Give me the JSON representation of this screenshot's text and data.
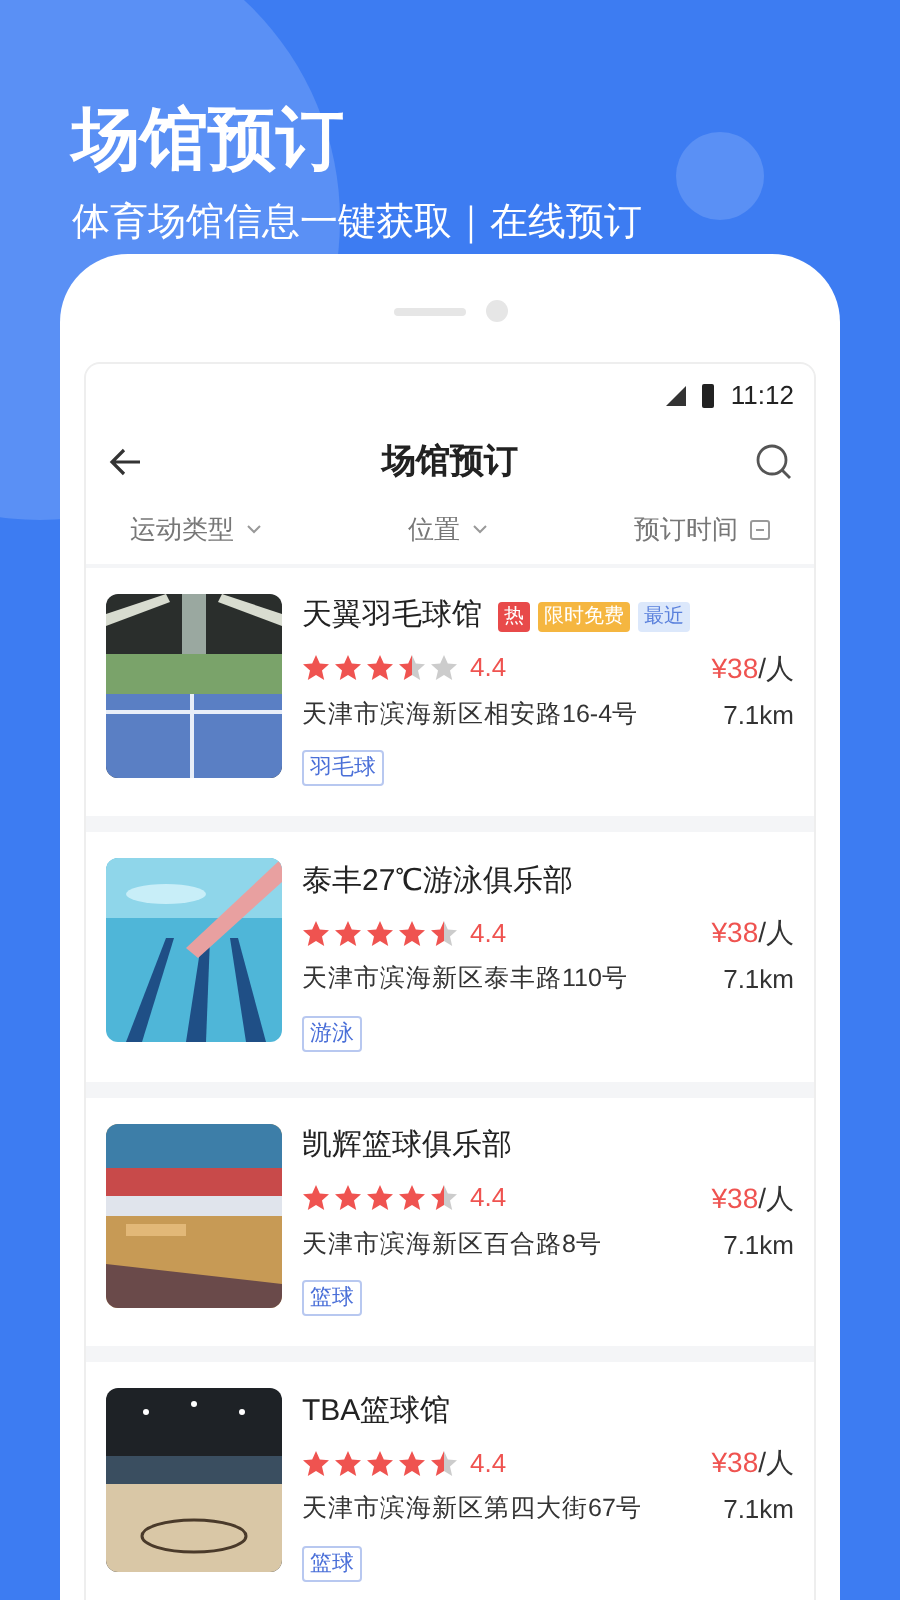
{
  "promo": {
    "title": "场馆预订",
    "subtitle": "体育场馆信息一键获取｜在线预订"
  },
  "status_bar": {
    "time": "11:12"
  },
  "header": {
    "title": "场馆预订"
  },
  "filters": [
    {
      "label": "运动类型",
      "kind": "dropdown"
    },
    {
      "label": "位置",
      "kind": "dropdown"
    },
    {
      "label": "预订时间",
      "kind": "calendar"
    }
  ],
  "venues": [
    {
      "name": "天翼羽毛球馆",
      "badges": [
        {
          "text": "热",
          "color": "#e84a4a"
        },
        {
          "text": "限时免费",
          "color": "#f5b640"
        },
        {
          "text": "最近",
          "color": "#dce8fb"
        }
      ],
      "stars": 3.5,
      "rating": "4.4",
      "price": "¥38",
      "unit": "/人",
      "address": "天津市滨海新区相安路16-4号",
      "distance": "7.1km",
      "tag": "羽毛球"
    },
    {
      "name": "泰丰27℃游泳俱乐部",
      "stars": 4.5,
      "rating": "4.4",
      "price": "¥38",
      "unit": "/人",
      "address": "天津市滨海新区泰丰路110号",
      "distance": "7.1km",
      "tag": "游泳"
    },
    {
      "name": "凯辉篮球俱乐部",
      "stars": 4.5,
      "rating": "4.4",
      "price": "¥38",
      "unit": "/人",
      "address": "天津市滨海新区百合路8号",
      "distance": "7.1km",
      "tag": "篮球"
    },
    {
      "name": "TBA篮球馆",
      "stars": 4.5,
      "rating": "4.4",
      "price": "¥38",
      "unit": "/人",
      "address": "天津市滨海新区第四大街67号",
      "distance": "7.1km",
      "tag": "篮球"
    }
  ]
}
